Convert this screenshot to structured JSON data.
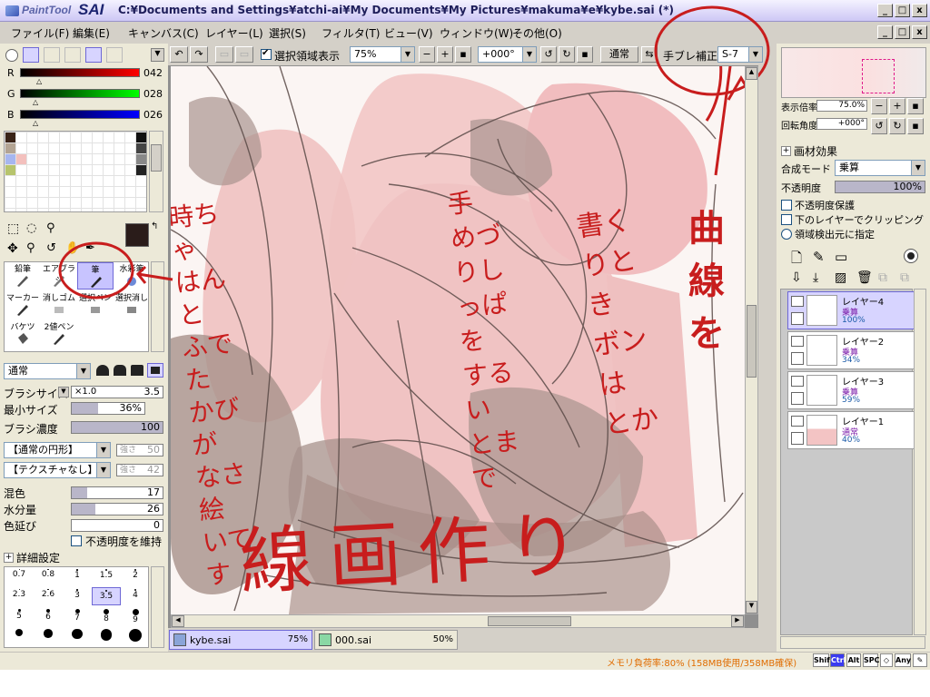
{
  "window": {
    "title": "C:¥Documents and Settings¥atchi-ai¥My Documents¥My Pictures¥makuma¥e¥kybe.sai (*)",
    "logo_small": "PaintTool",
    "logo_big": "SAI",
    "btn_min": "_",
    "btn_max": "□",
    "btn_close": "x"
  },
  "menu": [
    "ファイル(F)",
    "編集(E)",
    "キャンバス(C)",
    "レイヤー(L)",
    "選択(S)",
    "フィルタ(T)",
    "ビュー(V)",
    "ウィンドウ(W)",
    "その他(O)"
  ],
  "toolbar": {
    "selection_display": "選択領域表示",
    "zoom": "75%",
    "rotation": "+000°",
    "mode": "通常",
    "stabilizer_label": "手ブレ補正",
    "stabilizer_value": "S-7"
  },
  "color": {
    "r_label": "R",
    "r_value": "042",
    "g_label": "G",
    "g_value": "028",
    "b_label": "B",
    "b_value": "026",
    "current": "#2a1c1a",
    "swatches": [
      "#3a2418",
      "#b3a493",
      "#a6b6f0",
      "#b7c46d"
    ]
  },
  "tools": [
    {
      "label": "鉛筆",
      "icon": "pencil-icon"
    },
    {
      "label": "エアブラシ",
      "icon": "airbrush-icon"
    },
    {
      "label": "筆",
      "icon": "brush-icon"
    },
    {
      "label": "水彩筆",
      "icon": "watercolor-icon"
    },
    {
      "label": "マーカー",
      "icon": "marker-icon"
    },
    {
      "label": "消しゴム",
      "icon": "eraser-icon"
    },
    {
      "label": "選択ペン",
      "icon": "select-pen-icon"
    },
    {
      "label": "選択消し",
      "icon": "select-erase-icon"
    },
    {
      "label": "バケツ",
      "icon": "bucket-icon"
    },
    {
      "label": "2値ペン",
      "icon": "binary-pen-icon"
    }
  ],
  "brush": {
    "blend_mode": "通常",
    "size_label": "ブラシサイズ",
    "size_mult": "×1.0",
    "size_value": "3.5",
    "min_size_label": "最小サイズ",
    "min_size_value": "36%",
    "density_label": "ブラシ濃度",
    "density_value": "100",
    "shape": "【通常の円形】",
    "shape_strength_label": "強さ",
    "shape_strength_value": "50",
    "texture": "【テクスチャなし】",
    "texture_strength_label": "強さ",
    "texture_strength_value": "42",
    "blend_label": "混色",
    "blend_value": "17",
    "water_label": "水分量",
    "water_value": "26",
    "extend_label": "色延び",
    "extend_value": "0",
    "keep_opacity": "不透明度を維持",
    "detail_settings": "詳細設定",
    "sizes": [
      "0.7",
      "0.8",
      "1",
      "1.5",
      "2",
      "2.3",
      "2.6",
      "3",
      "3.5",
      "4",
      "5",
      "6",
      "7",
      "8",
      "9",
      "",
      "",
      "",
      "",
      ""
    ]
  },
  "navigator": {
    "zoom_label": "表示倍率",
    "zoom_value": "75.0%",
    "angle_label": "回転角度",
    "angle_value": "+000°"
  },
  "layer_panel": {
    "effects": "画材効果",
    "blend_label": "合成モード",
    "blend_value": "乗算",
    "opacity_label": "不透明度",
    "opacity_value": "100%",
    "preserve_opacity": "不透明度保護",
    "clipping": "下のレイヤーでクリッピング",
    "detect_source": "領域検出元に指定",
    "layers": [
      {
        "name": "レイヤー4",
        "mode": "乗算",
        "opacity": "100%"
      },
      {
        "name": "レイヤー2",
        "mode": "乗算",
        "opacity": "34%"
      },
      {
        "name": "レイヤー3",
        "mode": "乗算",
        "opacity": "59%"
      },
      {
        "name": "レイヤー1",
        "mode": "通常",
        "opacity": "40%"
      }
    ]
  },
  "tabs": [
    {
      "name": "kybe.sai",
      "zoom": "75%"
    },
    {
      "name": "000.sai",
      "zoom": "50%"
    }
  ],
  "status": {
    "memory": "メモリ負荷率:80% (158MB使用/358MB確保)",
    "keys": [
      "Shift",
      "Ctrl",
      "Alt",
      "SPC",
      "◇",
      "Any",
      "✎"
    ]
  },
  "annotations": {
    "left_note": [
      "時ちゃ",
      "はんと",
      "ふでた",
      "かびが",
      "なさ絵",
      "いてす"
    ],
    "mid_note": [
      "手",
      "めづ",
      "りし",
      "っぱを",
      "するい",
      "とまで"
    ],
    "right_note": [
      "書く",
      "りとき",
      "ボンは",
      "とか"
    ],
    "far_note": [
      "曲",
      "線を"
    ],
    "bottom_note": "線画作り",
    "note_color": "#c81d1d"
  }
}
